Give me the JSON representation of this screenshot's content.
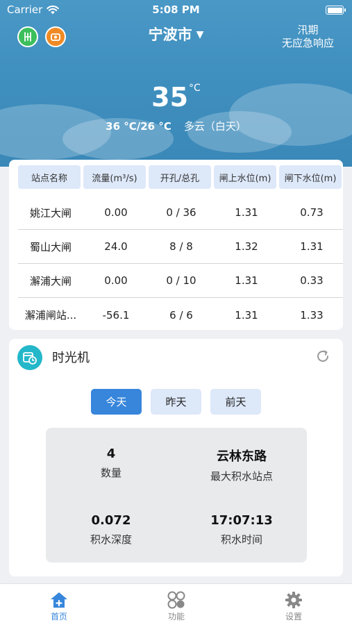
{
  "status_bar": {
    "carrier": "Carrier",
    "time": "5:08 PM"
  },
  "header": {
    "city": "宁波市",
    "flood_line1": "汛期",
    "flood_line2": "无应急响应",
    "temperature": "35",
    "temperature_unit": "°C",
    "temp_range": "36 °C/26 °C",
    "condition": "多云（白天）"
  },
  "station_table": {
    "headers": [
      "站点名称",
      "流量(m³/s)",
      "开孔/总孔",
      "闸上水位(m)",
      "闸下水位(m)"
    ],
    "rows": [
      [
        "姚江大闸",
        "0.00",
        "0 / 36",
        "1.31",
        "0.73"
      ],
      [
        "蜀山大闸",
        "24.0",
        "8 / 8",
        "1.32",
        "1.31"
      ],
      [
        "澥浦大闸",
        "0.00",
        "0 / 10",
        "1.31",
        "0.33"
      ],
      [
        "澥浦闸站...",
        "-56.1",
        "6 / 6",
        "1.31",
        "1.33"
      ]
    ]
  },
  "time_machine": {
    "title": "时光机",
    "tabs": [
      "今天",
      "昨天",
      "前天"
    ],
    "active_tab": "今天",
    "stats": [
      {
        "value": "4",
        "label": "数量"
      },
      {
        "value": "云林东路",
        "label": "最大积水站点"
      },
      {
        "value": "0.072",
        "label": "积水深度"
      },
      {
        "value": "17:07:13",
        "label": "积水时间"
      }
    ]
  },
  "tab_bar": {
    "items": [
      "首页",
      "功能",
      "设置"
    ],
    "active": "首页"
  },
  "colors": {
    "header_blue": "#4a98c6",
    "accent_blue": "#3786db",
    "table_header_bg": "#dde8f9",
    "time_icon_teal": "#23b7c9",
    "green_icon": "#3cbf5c",
    "orange_icon": "#f08a24"
  }
}
